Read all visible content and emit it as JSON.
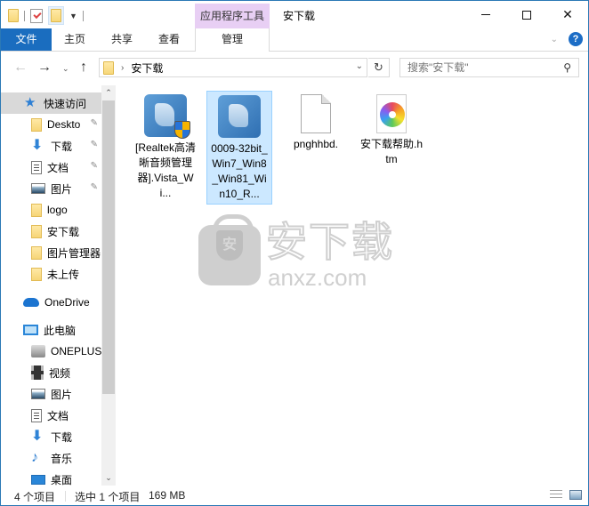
{
  "window": {
    "title": "安下载",
    "contextual_tab_group": "应用程序工具",
    "controls": {
      "minimize": "minimize",
      "maximize": "maximize",
      "close": "✕"
    }
  },
  "ribbon": {
    "tabs": [
      {
        "label": "文件"
      },
      {
        "label": "主页"
      },
      {
        "label": "共享"
      },
      {
        "label": "查看"
      },
      {
        "label": "管理"
      }
    ],
    "help": "?"
  },
  "nav": {
    "back": "←",
    "forward": "→",
    "recent": "⌄",
    "up": "↑",
    "address_crumbs": [
      "安下载"
    ],
    "crumb_separator": "›",
    "refresh": "↻",
    "search_placeholder": "搜索\"安下载\"",
    "search_icon": "⚲"
  },
  "sidebar": {
    "items": [
      {
        "label": "快速访问",
        "icon": "star-icon",
        "active": true
      },
      {
        "label": "Deskto",
        "icon": "folder-icon",
        "pinned": true
      },
      {
        "label": "下载",
        "icon": "download-icon",
        "pinned": true
      },
      {
        "label": "文档",
        "icon": "document-icon",
        "pinned": true
      },
      {
        "label": "图片",
        "icon": "picture-icon",
        "pinned": true
      },
      {
        "label": "logo",
        "icon": "folder-icon"
      },
      {
        "label": "安下载",
        "icon": "folder-icon"
      },
      {
        "label": "图片管理器",
        "icon": "folder-icon"
      },
      {
        "label": "未上传",
        "icon": "folder-icon"
      },
      {
        "label": "OneDrive",
        "icon": "cloud-icon"
      },
      {
        "label": "此电脑",
        "icon": "computer-icon"
      },
      {
        "label": "ONEPLUS",
        "icon": "drive-icon"
      },
      {
        "label": "视频",
        "icon": "video-icon"
      },
      {
        "label": "图片",
        "icon": "picture-icon"
      },
      {
        "label": "文档",
        "icon": "document-icon"
      },
      {
        "label": "下载",
        "icon": "download-icon"
      },
      {
        "label": "音乐",
        "icon": "music-icon"
      },
      {
        "label": "桌面",
        "icon": "desktop-icon"
      }
    ],
    "pin_glyph": "📌"
  },
  "files": [
    {
      "name": "[Realtek高清晰音频管理器].Vista_Wi...",
      "type": "installer-uac",
      "selected": false
    },
    {
      "name": "0009-32bit_Win7_Win8_Win81_Win10_R...",
      "type": "installer",
      "selected": true
    },
    {
      "name": "pnghhbd.",
      "type": "blank",
      "selected": false
    },
    {
      "name": "安下载帮助.htm",
      "type": "htm",
      "selected": false
    }
  ],
  "watermark": {
    "cn": "安下载",
    "en": "anxz.com",
    "shield_char": "安"
  },
  "status": {
    "item_count": "4 个项目",
    "selected": "选中 1 个项目",
    "size": "169 MB"
  }
}
